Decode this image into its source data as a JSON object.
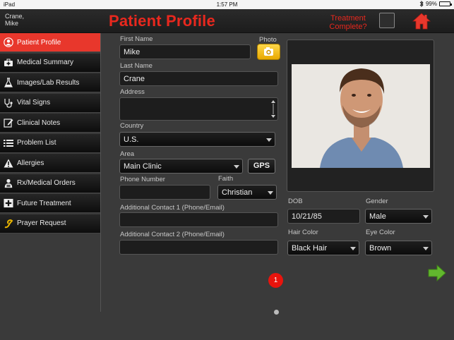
{
  "status_bar": {
    "device": "iPad",
    "time": "1:57 PM",
    "battery_text": "99%"
  },
  "header": {
    "patient_name_line1": "Crane,",
    "patient_name_line2": "Mike",
    "title": "Patient Profile",
    "treatment_label_line1": "Treatment",
    "treatment_label_line2": "Complete?",
    "accent_color": "#e8281e"
  },
  "sidebar": {
    "items": [
      {
        "label": "Patient Profile",
        "icon": "person-icon",
        "active": true
      },
      {
        "label": "Medical Summary",
        "icon": "medical-kit-icon"
      },
      {
        "label": "Images/Lab Results",
        "icon": "flask-icon"
      },
      {
        "label": "Vital Signs",
        "icon": "stethoscope-icon"
      },
      {
        "label": "Clinical Notes",
        "icon": "notepad-icon"
      },
      {
        "label": "Problem List",
        "icon": "list-icon"
      },
      {
        "label": "Allergies",
        "icon": "warning-icon"
      },
      {
        "label": "Rx/Medical Orders",
        "icon": "pharmacist-icon"
      },
      {
        "label": "Future Treatment",
        "icon": "plus-folder-icon"
      },
      {
        "label": "Prayer Request",
        "icon": "swirl-icon"
      }
    ]
  },
  "form": {
    "first_name": {
      "label": "First Name",
      "value": "Mike"
    },
    "photo_label": "Photo",
    "last_name": {
      "label": "Last Name",
      "value": "Crane"
    },
    "address": {
      "label": "Address",
      "value": ""
    },
    "country": {
      "label": "Country",
      "value": "U.S."
    },
    "area": {
      "label": "Area",
      "value": "Main Clinic"
    },
    "gps_label": "GPS",
    "phone": {
      "label": "Phone Number",
      "value": ""
    },
    "faith": {
      "label": "Faith",
      "value": "Christian"
    },
    "contact1": {
      "label": "Additional Contact 1 (Phone/Email)",
      "value": ""
    },
    "contact2": {
      "label": "Additional Contact 2 (Phone/Email)",
      "value": ""
    },
    "dob": {
      "label": "DOB",
      "value": "10/21/85"
    },
    "gender": {
      "label": "Gender",
      "value": "Male"
    },
    "hair_color": {
      "label": "Hair Color",
      "value": "Black Hair"
    },
    "eye_color": {
      "label": "Eye Color",
      "value": "Brown"
    }
  },
  "pagination": {
    "badge_count": "1"
  }
}
